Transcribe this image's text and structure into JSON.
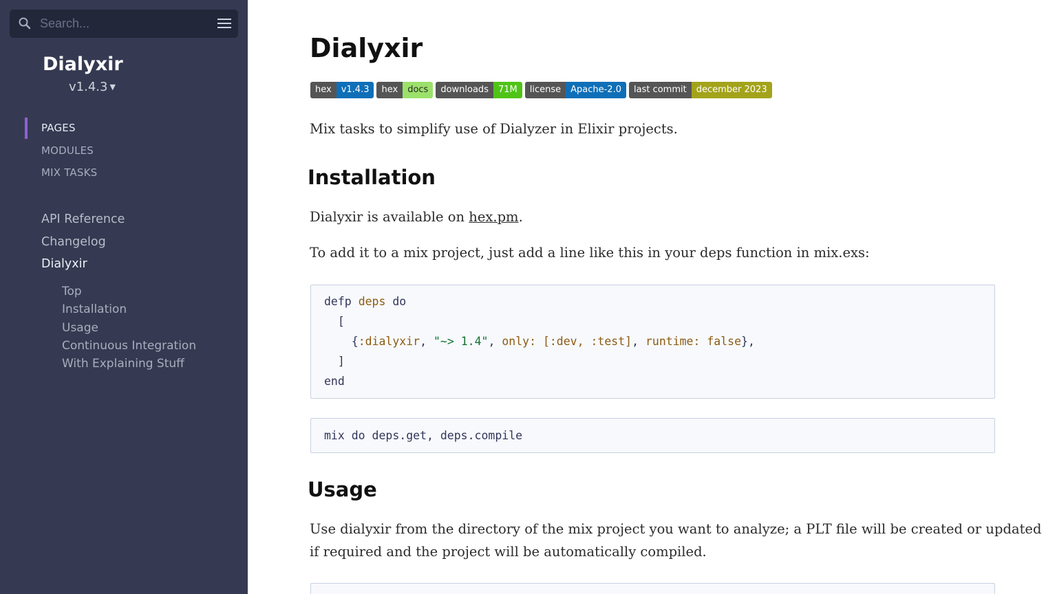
{
  "sidebar": {
    "search_placeholder": "Search...",
    "project_name": "Dialyxir",
    "version": "v1.4.3",
    "tabs": [
      {
        "label": "PAGES",
        "active": true
      },
      {
        "label": "MODULES",
        "active": false
      },
      {
        "label": "MIX TASKS",
        "active": false
      }
    ],
    "nav": [
      {
        "label": "API Reference"
      },
      {
        "label": "Changelog"
      },
      {
        "label": "Dialyxir"
      }
    ],
    "sub_nav": [
      {
        "label": "Top"
      },
      {
        "label": "Installation"
      },
      {
        "label": "Usage"
      },
      {
        "label": "Continuous Integration"
      },
      {
        "label": "With Explaining Stuff"
      }
    ],
    "accent_color": "#8e62d2"
  },
  "content": {
    "title": "Dialyxir",
    "badges": [
      {
        "left": "hex",
        "right": "v1.4.3",
        "color": "#0e6fb8"
      },
      {
        "left": "hex",
        "right": "docs",
        "color": "#9be16a"
      },
      {
        "left": "downloads",
        "right": "71M",
        "color": "#4fc417"
      },
      {
        "left": "license",
        "right": "Apache-2.0",
        "color": "#0e6fb8"
      },
      {
        "left": "last commit",
        "right": "december 2023",
        "color": "#a3a31b"
      }
    ],
    "intro": "Mix tasks to simplify use of Dialyzer in Elixir projects.",
    "installation_heading": "Installation",
    "available_prefix": "Dialyxir is available on ",
    "available_link": "hex.pm",
    "available_suffix": ".",
    "deps_instruction": "To add it to a mix project, just add a line like this in your deps function in mix.exs:",
    "code1": {
      "l1_kw1": "defp",
      "l1_fn": "deps",
      "l1_kw2": "do",
      "l2": "[",
      "l3_open": "{",
      "l3_atom1": ":dialyxir",
      "l3_comma1": ",",
      "l3_str": "\"~> 1.4\"",
      "l3_comma2": ",",
      "l3_key1": "only:",
      "l3_list": "[:dev, :test]",
      "l3_comma3": ",",
      "l3_key2": "runtime:",
      "l3_bool": "false",
      "l3_close": "},",
      "l4": "]",
      "l5": "end"
    },
    "code2": "mix do deps.get, deps.compile",
    "usage_heading": "Usage",
    "usage_text_1": "Use dialyxir from the directory of the mix project you want to analyze; a PLT file will be created or updated",
    "usage_text_2": "if required and the project will be automatically compiled."
  }
}
